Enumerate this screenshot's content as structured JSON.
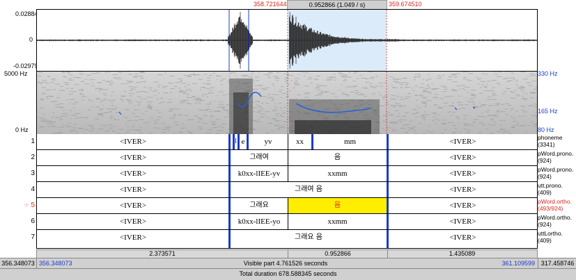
{
  "top_ruler": {
    "sel_start": "358.721644",
    "sel_len": "0.952866 (1.049 / s)",
    "sel_end": "359.674510"
  },
  "waveform": {
    "y_max": "0.02884",
    "y_zero": "0",
    "y_min": "-0.02979"
  },
  "spectrogram": {
    "freq_max": "5000 Hz",
    "freq_min": "0 Hz",
    "pitch_max": "330 Hz",
    "pitch_mid": "165 Hz",
    "pitch_min": "80 Hz"
  },
  "tiers": [
    {
      "num": "1",
      "name": [
        "phoneme",
        "(3341)"
      ],
      "a": "<IVER>",
      "b": [
        "l",
        "e",
        "yv"
      ],
      "c": [
        "xx",
        "mm"
      ],
      "d": "<IVER>"
    },
    {
      "num": "2",
      "name": [
        "pWord.prono.",
        "(924)"
      ],
      "a": "<IVER>",
      "b": "그래여",
      "c": "음",
      "d": "<IVER>"
    },
    {
      "num": "3",
      "name": [
        "pWord.prono.",
        "(924)"
      ],
      "a": "<IVER>",
      "b": "k0xx-lIEE-yv",
      "c": "xxmm",
      "d": "<IVER>"
    },
    {
      "num": "4",
      "name": [
        "utt.prono.",
        "(409)"
      ],
      "a": "<IVER>",
      "bc": "그래여 음",
      "d": "<IVER>"
    },
    {
      "num": "5",
      "marker": "☞",
      "name": [
        "pWord.ortho.",
        "(493/924)"
      ],
      "a": "<IVER>",
      "b": "그래요",
      "c": "음",
      "d": "<IVER>"
    },
    {
      "num": "6",
      "name": [
        "pWord.ortho.",
        "(924)"
      ],
      "a": "<IVER>",
      "b": "k0xx-lIEE-yo",
      "c": "xxmm",
      "d": "<IVER>"
    },
    {
      "num": "7",
      "name": [
        "uttLortho.",
        "(409)"
      ],
      "a": "<IVER>",
      "bc": "그래요 음",
      "d": "<IVER>"
    }
  ],
  "durations": {
    "left": "2.373571",
    "mid": "0.952866",
    "right": "1.435089"
  },
  "visible": {
    "outer_left": "356.348073",
    "inner_left": "356.348073",
    "label": "Visible part 4.761526 seconds",
    "inner_right": "361.109599",
    "outer_right": "317.458746"
  },
  "total": {
    "label": "Total duration 678.588345 seconds"
  },
  "colors": {
    "selection": "#dcebfa",
    "highlight": "#ffee00",
    "boundary": "#1a3cc8",
    "red": "#d22a1e",
    "pitch": "#2a62d6"
  }
}
